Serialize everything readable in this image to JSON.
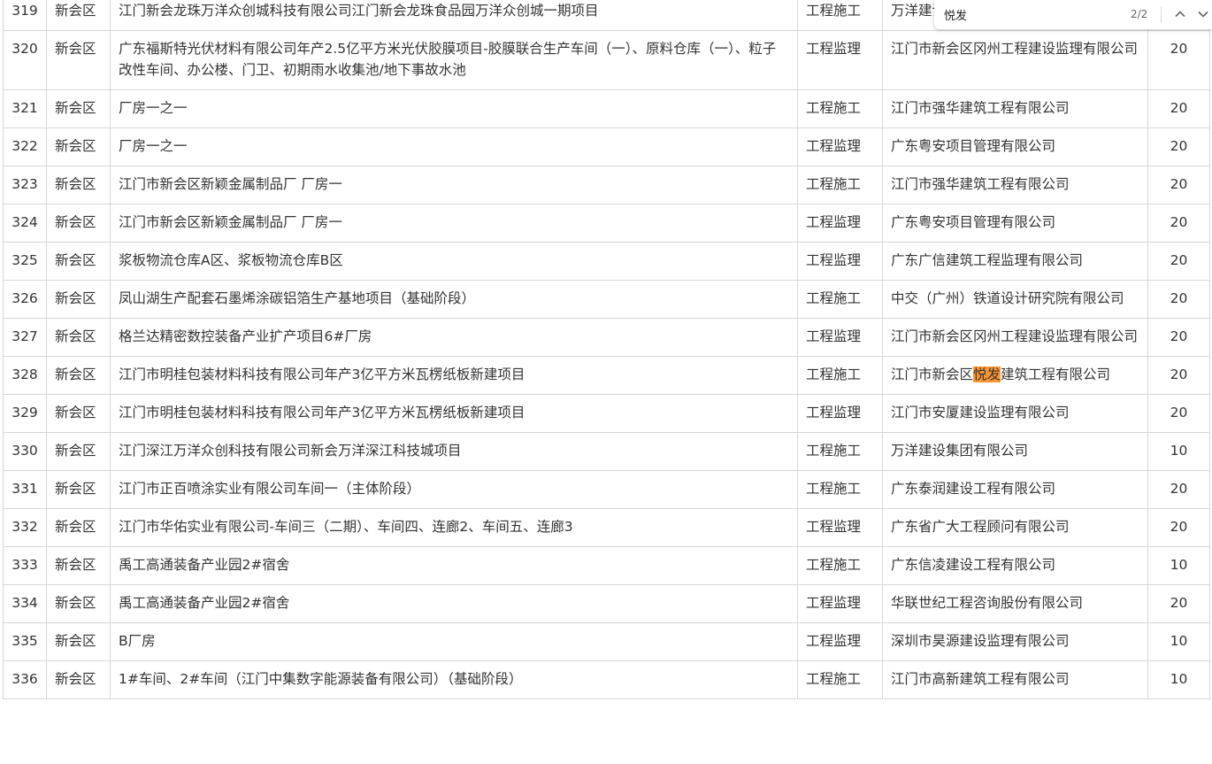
{
  "rows": [
    {
      "no": "319",
      "region": "新会区",
      "project": "江门新会龙珠万洋众创城科技有限公司江门新会龙珠食品园万洋众创城一期项目",
      "type": "工程施工",
      "company": "万洋建设集团有限公司",
      "score": "20"
    },
    {
      "no": "320",
      "region": "新会区",
      "project": "广东福斯特光伏材料有限公司年产2.5亿平方米光伏胶膜项目-胶膜联合生产车间（一）、原料仓库（一）、粒子改性车间、办公楼、门卫、初期雨水收集池/地下事故水池",
      "type": "工程监理",
      "company": "江门市新会区冈州工程建设监理有限公司",
      "score": "20"
    },
    {
      "no": "321",
      "region": "新会区",
      "project": "厂房一之一",
      "type": "工程施工",
      "company": "江门市强华建筑工程有限公司",
      "score": "20"
    },
    {
      "no": "322",
      "region": "新会区",
      "project": "厂房一之一",
      "type": "工程监理",
      "company": "广东粤安项目管理有限公司",
      "score": "20"
    },
    {
      "no": "323",
      "region": "新会区",
      "project": "江门市新会区新颖金属制品厂 厂房一",
      "type": "工程施工",
      "company": "江门市强华建筑工程有限公司",
      "score": "20"
    },
    {
      "no": "324",
      "region": "新会区",
      "project": "江门市新会区新颖金属制品厂 厂房一",
      "type": "工程监理",
      "company": "广东粤安项目管理有限公司",
      "score": "20"
    },
    {
      "no": "325",
      "region": "新会区",
      "project": "浆板物流仓库A区、浆板物流仓库B区",
      "type": "工程监理",
      "company": "广东广信建筑工程监理有限公司",
      "score": "20"
    },
    {
      "no": "326",
      "region": "新会区",
      "project": "凤山湖生产配套石墨烯涂碳铝箔生产基地项目（基础阶段）",
      "type": "工程施工",
      "company": "中交（广州）铁道设计研究院有限公司",
      "score": "20"
    },
    {
      "no": "327",
      "region": "新会区",
      "project": "格兰达精密数控装备产业扩产项目6#厂房",
      "type": "工程监理",
      "company": "江门市新会区冈州工程建设监理有限公司",
      "score": "20"
    },
    {
      "no": "328",
      "region": "新会区",
      "project": "江门市明桂包装材料科技有限公司年产3亿平方米瓦楞纸板新建项目",
      "type": "工程施工",
      "company_pre": "江门市新会区",
      "company_hl": "悦发",
      "company_post": "建筑工程有限公司",
      "score": "20"
    },
    {
      "no": "329",
      "region": "新会区",
      "project": "江门市明桂包装材料科技有限公司年产3亿平方米瓦楞纸板新建项目",
      "type": "工程监理",
      "company": "江门市安厦建设监理有限公司",
      "score": "20"
    },
    {
      "no": "330",
      "region": "新会区",
      "project": "江门深江万洋众创科技有限公司新会万洋深江科技城项目",
      "type": "工程施工",
      "company": "万洋建设集团有限公司",
      "score": "10"
    },
    {
      "no": "331",
      "region": "新会区",
      "project": "江门市正百喷涂实业有限公司车间一（主体阶段）",
      "type": "工程施工",
      "company": "广东泰润建设工程有限公司",
      "score": "20"
    },
    {
      "no": "332",
      "region": "新会区",
      "project": "江门市华佑实业有限公司-车间三（二期）、车间四、连廊2、车间五、连廊3",
      "type": "工程监理",
      "company": "广东省广大工程顾问有限公司",
      "score": "20"
    },
    {
      "no": "333",
      "region": "新会区",
      "project": "禹工高通装备产业园2#宿舍",
      "type": "工程施工",
      "company": "广东信凌建设工程有限公司",
      "score": "10"
    },
    {
      "no": "334",
      "region": "新会区",
      "project": "禹工高通装备产业园2#宿舍",
      "type": "工程监理",
      "company": "华联世纪工程咨询股份有限公司",
      "score": "20"
    },
    {
      "no": "335",
      "region": "新会区",
      "project": "B厂房",
      "type": "工程监理",
      "company": "深圳市昊源建设监理有限公司",
      "score": "10"
    },
    {
      "no": "336",
      "region": "新会区",
      "project": "1#车间、2#车间（江门中集数字能源装备有限公司）（基础阶段）",
      "type": "工程施工",
      "company": "江门市高新建筑工程有限公司",
      "score": "10"
    }
  ],
  "find": {
    "query": "悦发",
    "count": "2/2",
    "prev_icon": "chevron-up-icon",
    "next_icon": "chevron-down-icon"
  },
  "colors": {
    "highlight": "#ff9632",
    "border": "#d6d6d6",
    "text": "#333333"
  }
}
